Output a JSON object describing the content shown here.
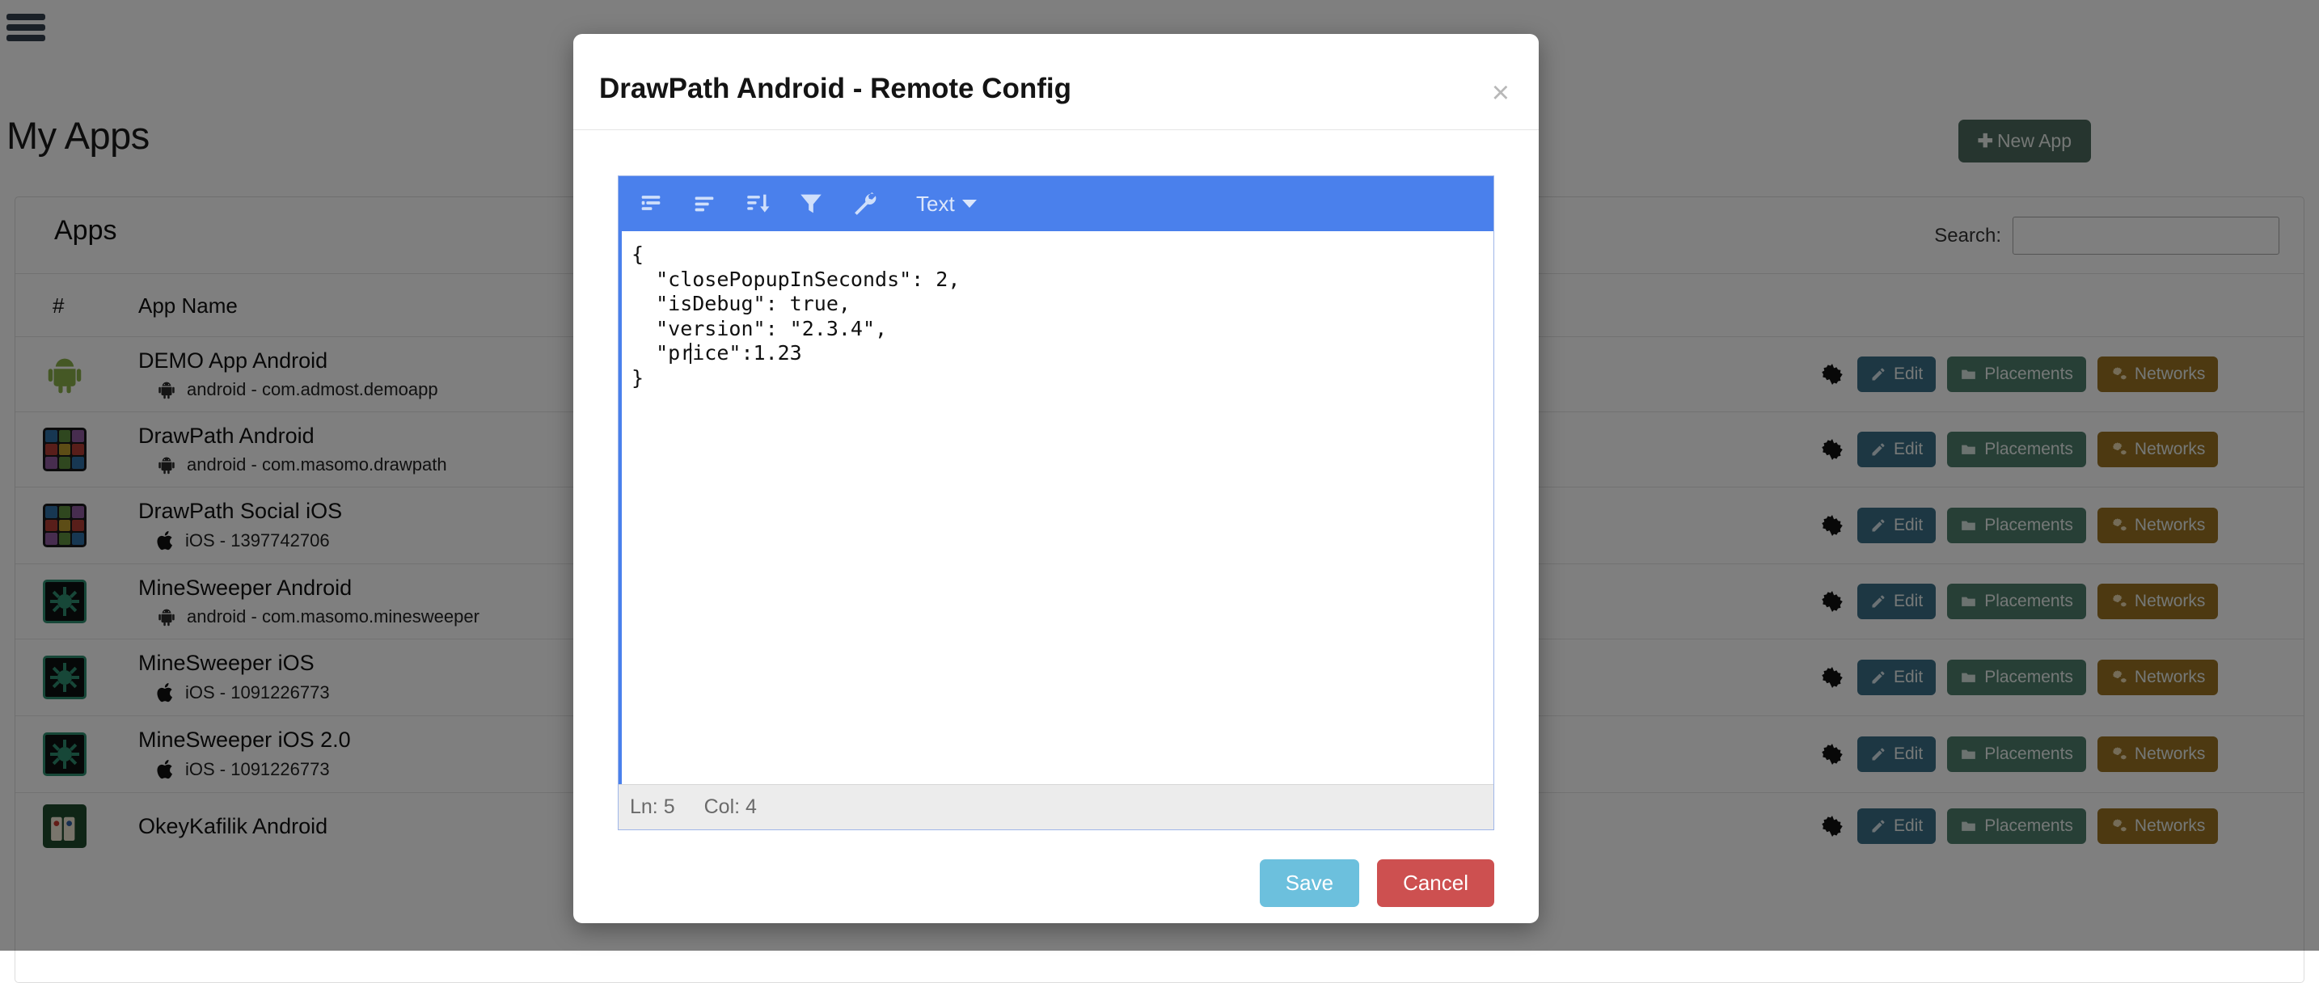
{
  "window": {
    "menu_icon": "hamburger-icon"
  },
  "page": {
    "title": "My Apps",
    "new_app_label": "New App",
    "new_app_icon": "plus-icon",
    "panel_title": "Apps",
    "search_label": "Search:",
    "search_value": "",
    "search_placeholder": "",
    "columns": [
      "#",
      "App Name"
    ],
    "action_labels": {
      "settings_icon": "gear-icon",
      "edit": "Edit",
      "edit_icon": "pencil-icon",
      "placements": "Placements",
      "placements_icon": "folder-icon",
      "networks": "Networks",
      "networks_icon": "gears-icon"
    },
    "rows": [
      {
        "name": "DEMO App Android",
        "platform_icon": "android-icon",
        "sub": "android - com.admost.demoapp",
        "icon": "android-robot"
      },
      {
        "name": "DrawPath Android",
        "platform_icon": "android-icon",
        "sub": "android - com.masomo.drawpath",
        "icon": "drawpath-grid"
      },
      {
        "name": "DrawPath Social iOS",
        "platform_icon": "apple-icon",
        "sub": "iOS - 1397742706",
        "icon": "drawpath-grid"
      },
      {
        "name": "MineSweeper Android",
        "platform_icon": "android-icon",
        "sub": "android - com.masomo.minesweeper",
        "icon": "minesweeper"
      },
      {
        "name": "MineSweeper iOS",
        "platform_icon": "apple-icon",
        "sub": "iOS - 1091226773",
        "icon": "minesweeper"
      },
      {
        "name": "MineSweeper iOS 2.0",
        "platform_icon": "apple-icon",
        "sub": "iOS - 1091226773",
        "icon": "minesweeper"
      },
      {
        "name": "OkeyKafilik Android",
        "platform_icon": "android-icon",
        "sub": "",
        "icon": "okey"
      }
    ]
  },
  "modal": {
    "title": "DrawPath Android - Remote Config",
    "close_label": "×",
    "close_icon": "close-icon",
    "toolbar": {
      "icons": [
        "compact-format-icon",
        "format-icon",
        "sort-icon",
        "filter-icon",
        "repair-icon"
      ],
      "mode_label": "Text",
      "mode_caret_icon": "chevron-down-icon"
    },
    "code_lines": [
      "{",
      "  \"closePopupInSeconds\": 2,",
      "  \"isDebug\": true,",
      "  \"version\": \"2.3.4\",",
      "  \"price\":1.23",
      "}"
    ],
    "status": {
      "line": "Ln: 5",
      "column": "Col: 4"
    },
    "save_label": "Save",
    "cancel_label": "Cancel"
  },
  "colors": {
    "toolbar_blue": "#4a80ec",
    "save_blue": "#6cc0dd",
    "cancel_red": "#cd5050",
    "new_app_green": "#4d6b5f",
    "edit_blue": "#3b6e86",
    "placements_green": "#4e7f6d",
    "networks_gold": "#9a7322"
  }
}
